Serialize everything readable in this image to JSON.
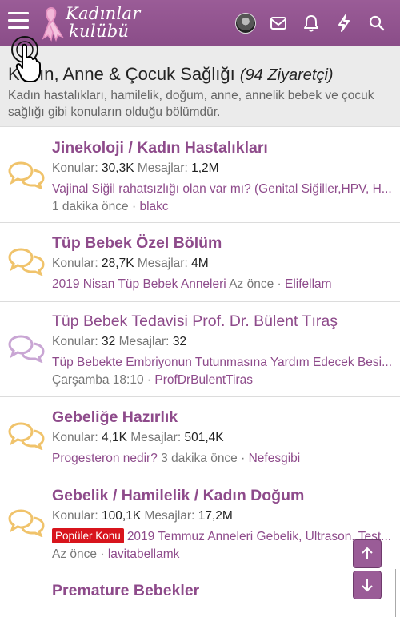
{
  "header": {
    "logo_line1": "Kadınlar",
    "logo_line2": "kulübü",
    "title": "Kadın, Anne & Çocuk Sağlığı",
    "visitors": "(94 Ziyaretçi)",
    "description": "Kadın hastalıkları, hamilelik, doğum, anne, annelik bebek ve çocuk sağlığı gibi konuların olduğu bölümdür."
  },
  "nav_icons": [
    "avatar",
    "envelope-icon",
    "bell-icon",
    "bolt-icon",
    "search-icon"
  ],
  "colors": {
    "brand": "#9a5c97",
    "link": "#8e4b8b",
    "icon_read": "#f0c36b",
    "icon_unread": "#c9a6d4",
    "badge": "#d8141c"
  },
  "labels": {
    "threads": "Konular:",
    "messages": "Mesajlar:"
  },
  "nodes": [
    {
      "title": "Jinekoloji / Kadın Hastalıkları",
      "threads": "30,3K",
      "messages": "1,2M",
      "latest": "Vajinal Siğil rahatsızlığı olan var mı? (Genital Siğiller,HPV, H...",
      "time": "1 dakika önce",
      "user": "blakc"
    },
    {
      "title": "Tüp Bebek Özel Bölüm",
      "threads": "28,7K",
      "messages": "4M",
      "latest": "2019 Nisan Tüp Bebek Anneleri",
      "time": "Az önce",
      "user": "Elifellam"
    },
    {
      "title": "Tüp Bebek Tedavisi Prof. Dr. Bülent Tıraş",
      "threads": "32",
      "messages": "32",
      "latest": "Tüp Bebekte Embriyonun Tutunmasına Yardım Edecek Besi...",
      "time": "Çarşamba 18:10",
      "user": "ProfDrBulentTiras"
    },
    {
      "title": "Gebeliğe Hazırlık",
      "threads": "4,1K",
      "messages": "501,4K",
      "latest": "Progesteron nedir?",
      "time": "3 dakika önce",
      "user": "Nefesgibi"
    },
    {
      "title": "Gebelik / Hamilelik / Kadın Doğum",
      "threads": "100,1K",
      "messages": "17,2M",
      "badge": "Popüler Konu",
      "latest": "2019 Temmuz Anneleri Gebelik, Ultrason, Test...",
      "time": "Az önce",
      "user": "lavitabellamk"
    },
    {
      "title": "Premature Bebekler"
    }
  ],
  "separator": "·"
}
